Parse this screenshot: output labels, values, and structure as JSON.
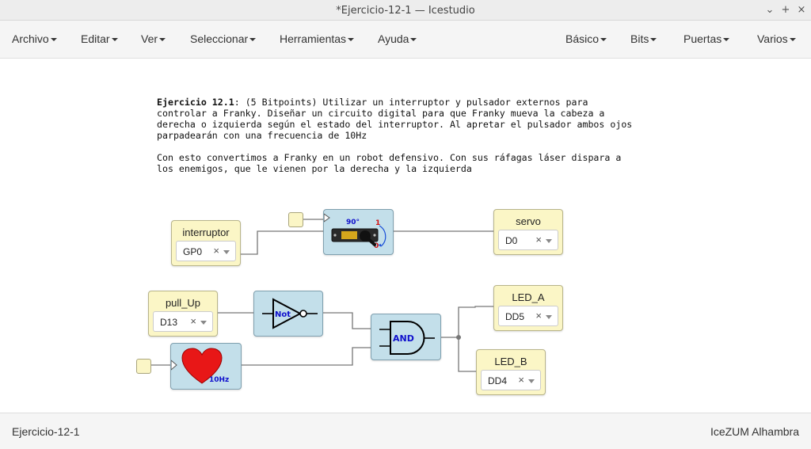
{
  "window": {
    "title": "*Ejercicio-12-1 — Icestudio",
    "minimize": "⌄",
    "maximize": "+",
    "close": "×"
  },
  "menu": {
    "left": [
      "Archivo",
      "Editar",
      "Ver",
      "Seleccionar",
      "Herramientas",
      "Ayuda"
    ],
    "right": [
      "Básico",
      "Bits",
      "Puertas",
      "Varios"
    ]
  },
  "info": {
    "bold": "Ejercicio 12.1",
    "text1": ": (5 Bitpoints) Utilizar un interruptor y pulsador externos para\ncontrolar a Franky. Diseñar un circuito digital para que Franky mueva la cabeza a\nderecha o izquierda según el estado del interruptor. Al apretar el pulsador ambos ojos\nparpadearán con una frecuencia de 10Hz",
    "text2": "Con esto convertimos a Franky en un robot defensivo. Con sus ráfagas láser dispara a\nlos enemigos, que le vienen por la derecha y la izquierda"
  },
  "ports": {
    "interruptor": {
      "label": "interruptor",
      "value": "GP0"
    },
    "servo": {
      "label": "servo",
      "value": "D0"
    },
    "pull_up": {
      "label": "pull_Up",
      "value": "D13"
    },
    "led_a": {
      "label": "LED_A",
      "value": "DD5"
    },
    "led_b": {
      "label": "LED_B",
      "value": "DD4"
    },
    "clear": "×"
  },
  "blocks": {
    "servo": {
      "angle": "90°",
      "one": "1",
      "zero": "0",
      "chip": "Futaba 3003"
    },
    "not": {
      "label": "Not"
    },
    "and": {
      "label": "AND"
    },
    "heart": {
      "freq": "10Hz"
    }
  },
  "colors": {
    "port_fill": "#fbf6c6",
    "block_fill": "#c3dfea",
    "heart": "#e81717",
    "label_blue": "#1010cc"
  },
  "status": {
    "file": "Ejercicio-12-1",
    "board": "IceZUM Alhambra"
  }
}
